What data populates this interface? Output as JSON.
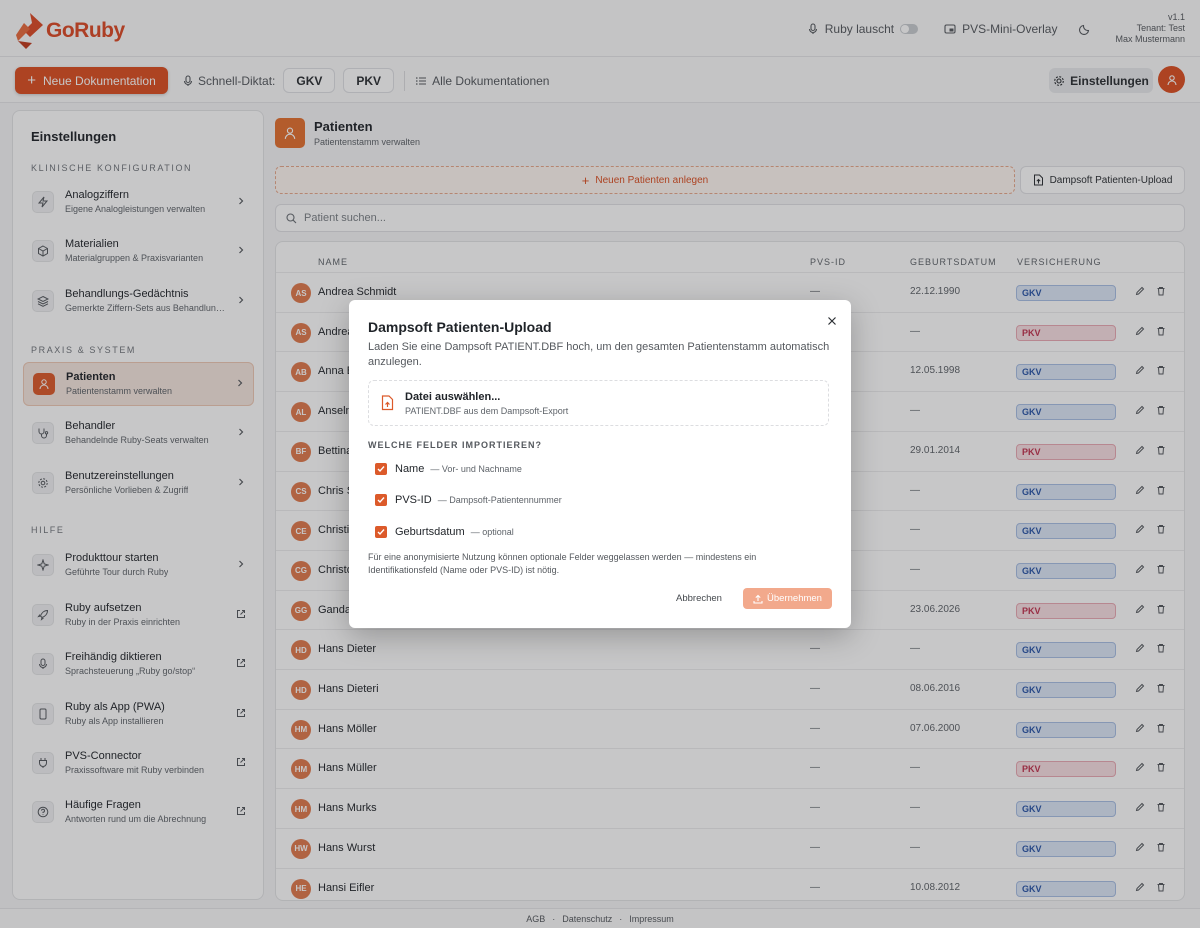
{
  "app": {
    "name": "GoRuby",
    "brand_color": "#dc4f22"
  },
  "topbar": {
    "ruby_listening": "Ruby lauscht",
    "pvs_overlay": "PVS-Mini-Overlay",
    "version": "v1.1",
    "tenant": "Tenant: Test",
    "user": "Max Mustermann"
  },
  "toolbar": {
    "new_doc": "Neue Dokumentation",
    "quick_dictation": "Schnell-Diktat:",
    "gkv": "GKV",
    "pkv": "PKV",
    "all_docs": "Alle Dokumentationen",
    "settings": "Einstellungen"
  },
  "sidebar": {
    "title": "Einstellungen",
    "sections": [
      {
        "label": "KLINISCHE KONFIGURATION"
      },
      {
        "label": "PRAXIS & SYSTEM"
      },
      {
        "label": "HILFE"
      }
    ],
    "items": [
      {
        "title": "Analogziffern",
        "subtitle": "Eigene Analogleistungen verwalten",
        "icon": "bolt-icon"
      },
      {
        "title": "Materialien",
        "subtitle": "Materialgruppen & Praxisvarianten",
        "icon": "cube-icon"
      },
      {
        "title": "Behandlungs-Gedächtnis",
        "subtitle": "Gemerkte Ziffern-Sets aus Behandlungen",
        "icon": "layers-icon"
      },
      {
        "title": "Patienten",
        "subtitle": "Patientenstamm verwalten",
        "icon": "user-icon"
      },
      {
        "title": "Behandler",
        "subtitle": "Behandelnde Ruby-Seats verwalten",
        "icon": "stethoscope-icon"
      },
      {
        "title": "Benutzereinstellungen",
        "subtitle": "Persönliche Vorlieben & Zugriff",
        "icon": "gear-icon"
      },
      {
        "title": "Produkttour starten",
        "subtitle": "Geführte Tour durch Ruby",
        "icon": "sparkle-icon"
      },
      {
        "title": "Ruby aufsetzen",
        "subtitle": "Ruby in der Praxis einrichten",
        "icon": "rocket-icon"
      },
      {
        "title": "Freihändig diktieren",
        "subtitle": "Sprachsteuerung „Ruby go/stop“",
        "icon": "mic-icon"
      },
      {
        "title": "Ruby als App (PWA)",
        "subtitle": "Ruby als App installieren",
        "icon": "phone-icon"
      },
      {
        "title": "PVS-Connector",
        "subtitle": "Praxissoftware mit Ruby verbinden",
        "icon": "plug-icon"
      },
      {
        "title": "Häufige Fragen",
        "subtitle": "Antworten rund um die Abrechnung",
        "icon": "help-icon"
      }
    ]
  },
  "main": {
    "title": "Patienten",
    "subtitle": "Patientenstamm verwalten",
    "new_patient": "Neuen Patienten anlegen",
    "upload": "Dampsoft Patienten-Upload",
    "search_placeholder": "Patient suchen...",
    "columns": {
      "name": "NAME",
      "pvs_id": "PVS-ID",
      "birthdate": "GEBURTSDATUM",
      "insurance": "VERSICHERUNG"
    },
    "rows": [
      {
        "initials": "AS",
        "name": "Andrea Schmidt",
        "pvs": "—",
        "birth": "22.12.1990",
        "ins": "GKV"
      },
      {
        "initials": "AS",
        "name": "Andrea",
        "pvs": "—",
        "birth": "—",
        "ins": "PKV"
      },
      {
        "initials": "AB",
        "name": "Anna B",
        "pvs": "—",
        "birth": "12.05.1998",
        "ins": "GKV"
      },
      {
        "initials": "AL",
        "name": "Anseln",
        "pvs": "—",
        "birth": "—",
        "ins": "GKV"
      },
      {
        "initials": "BF",
        "name": "Bettina",
        "pvs": "—",
        "birth": "29.01.2014",
        "ins": "PKV"
      },
      {
        "initials": "CS",
        "name": "Chris S",
        "pvs": "—",
        "birth": "—",
        "ins": "GKV"
      },
      {
        "initials": "CE",
        "name": "Christi",
        "pvs": "—",
        "birth": "—",
        "ins": "GKV"
      },
      {
        "initials": "CG",
        "name": "Christo",
        "pvs": "—",
        "birth": "—",
        "ins": "GKV"
      },
      {
        "initials": "GG",
        "name": "Ganda",
        "pvs": "—",
        "birth": "23.06.2026",
        "ins": "PKV"
      },
      {
        "initials": "HD",
        "name": "Hans Dieter",
        "pvs": "—",
        "birth": "—",
        "ins": "GKV"
      },
      {
        "initials": "HD",
        "name": "Hans Dieteri",
        "pvs": "—",
        "birth": "08.06.2016",
        "ins": "GKV"
      },
      {
        "initials": "HM",
        "name": "Hans Möller",
        "pvs": "—",
        "birth": "07.06.2000",
        "ins": "GKV"
      },
      {
        "initials": "HM",
        "name": "Hans Müller",
        "pvs": "—",
        "birth": "—",
        "ins": "PKV"
      },
      {
        "initials": "HM",
        "name": "Hans Murks",
        "pvs": "—",
        "birth": "—",
        "ins": "GKV"
      },
      {
        "initials": "HW",
        "name": "Hans Wurst",
        "pvs": "—",
        "birth": "—",
        "ins": "GKV"
      },
      {
        "initials": "HE",
        "name": "Hansi Eifler",
        "pvs": "—",
        "birth": "10.08.2012",
        "ins": "GKV"
      }
    ]
  },
  "footer": {
    "agb": "AGB",
    "privacy": "Datenschutz",
    "imprint": "Impressum",
    "sep": "·"
  },
  "modal": {
    "title": "Dampsoft Patienten-Upload",
    "description": "Laden Sie eine Dampsoft PATIENT.DBF hoch, um den gesamten Patientenstamm automatisch anzulegen.",
    "file_title": "Datei auswählen...",
    "file_hint": "PATIENT.DBF aus dem Dampsoft-Export",
    "fields_heading": "WELCHE FELDER IMPORTIEREN?",
    "fields": [
      {
        "label": "Name",
        "hint": "— Vor- und Nachname",
        "checked": true
      },
      {
        "label": "PVS-ID",
        "hint": "— Dampsoft-Patientennummer",
        "checked": true
      },
      {
        "label": "Geburtsdatum",
        "hint": "— optional",
        "checked": true
      }
    ],
    "note": "Für eine anonymisierte Nutzung können optionale Felder weggelassen werden — mindestens ein Identifikationsfeld (Name oder PVS-ID) ist nötig.",
    "cancel": "Abbrechen",
    "confirm": "Übernehmen"
  }
}
